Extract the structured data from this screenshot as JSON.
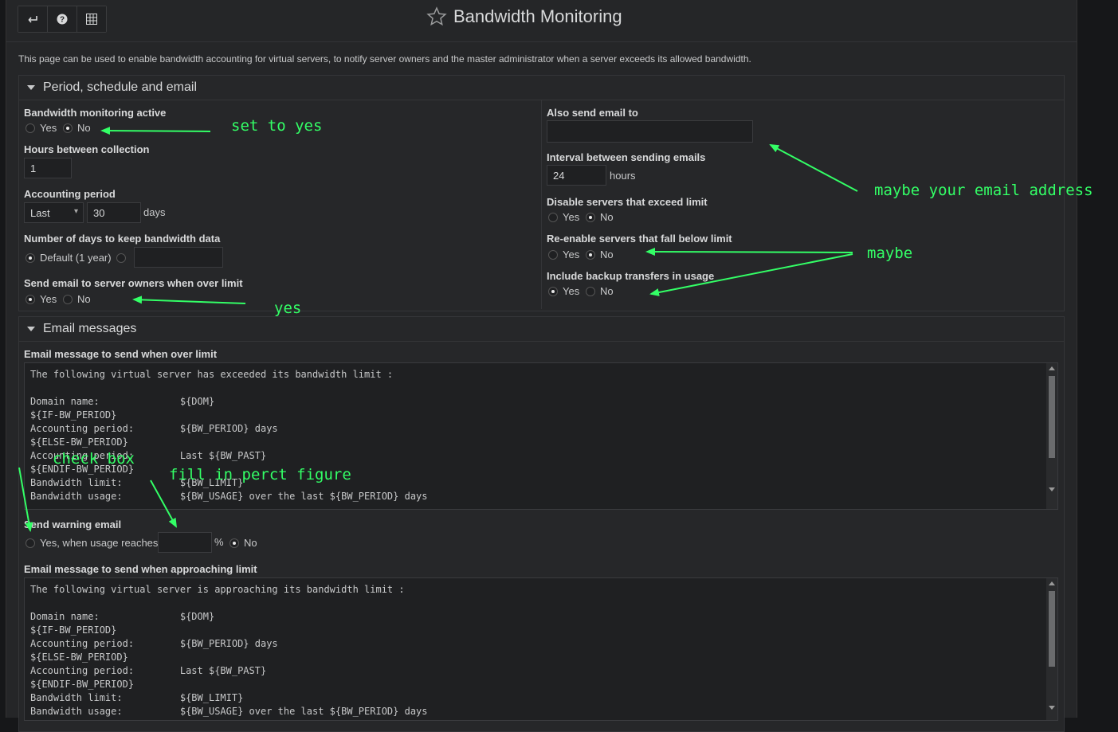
{
  "header": {
    "title": "Bandwidth Monitoring"
  },
  "toolbar": {
    "icons": [
      "return-icon",
      "help-icon",
      "grid-icon"
    ]
  },
  "intro": "This page can be used to enable bandwidth accounting for virtual servers, to notify server owners and the master administrator when a server exceeds its allowed bandwidth.",
  "period": {
    "title": "Period, schedule and email",
    "active": {
      "label": "Bandwidth monitoring active",
      "yes": "Yes",
      "no": "No",
      "selected": "No"
    },
    "hours": {
      "label": "Hours between collection",
      "value": "1"
    },
    "accounting": {
      "label": "Accounting period",
      "select": "Last",
      "value": "30",
      "unit": "days"
    },
    "keep": {
      "label": "Number of days to keep bandwidth data",
      "default": "Default (1 year)",
      "selected": "Default (1 year)"
    },
    "owners": {
      "label": "Send email to server owners when over limit",
      "yes": "Yes",
      "no": "No",
      "selected": "Yes"
    },
    "also": {
      "label": "Also send email to",
      "value": ""
    },
    "interval": {
      "label": "Interval between sending emails",
      "value": "24",
      "unit": "hours"
    },
    "disable": {
      "label": "Disable servers that exceed limit",
      "yes": "Yes",
      "no": "No",
      "selected": "No"
    },
    "reenable": {
      "label": "Re-enable servers that fall below limit",
      "yes": "Yes",
      "no": "No",
      "selected": "No"
    },
    "backup": {
      "label": "Include backup transfers in usage",
      "yes": "Yes",
      "no": "No",
      "selected": "Yes"
    }
  },
  "email": {
    "title": "Email messages",
    "over": {
      "label": "Email message to send when over limit",
      "lines": [
        "The following virtual server has exceeded its bandwidth limit :",
        "",
        "Domain name:              ${DOM}",
        "${IF-BW_PERIOD}",
        "Accounting period:        ${BW_PERIOD} days",
        "${ELSE-BW_PERIOD}",
        "Accounting period:        Last ${BW_PAST}",
        "${ENDIF-BW_PERIOD}",
        "Bandwidth limit:          ${BW_LIMIT}",
        "Bandwidth usage:          ${BW_USAGE} over the last ${BW_PERIOD} days"
      ]
    },
    "warning": {
      "label": "Send warning email",
      "yes": "Yes, when usage reaches",
      "pct": "%",
      "no": "No",
      "value": "",
      "selected": "No"
    },
    "approach": {
      "label": "Email message to send when approaching limit",
      "lines": [
        "The following virtual server is approaching its bandwidth limit :",
        "",
        "Domain name:              ${DOM}",
        "${IF-BW_PERIOD}",
        "Accounting period:        ${BW_PERIOD} days",
        "${ELSE-BW_PERIOD}",
        "Accounting period:        Last ${BW_PAST}",
        "${ENDIF-BW_PERIOD}",
        "Bandwidth limit:          ${BW_LIMIT}",
        "Bandwidth usage:          ${BW_USAGE} over the last ${BW_PERIOD} days"
      ]
    }
  },
  "annotations": {
    "set_yes": "set to yes",
    "email": "maybe your email address",
    "maybe": "maybe",
    "yes": "yes",
    "check_box": "check box",
    "fill": "fill in perct figure",
    "color": "#33ff66"
  }
}
